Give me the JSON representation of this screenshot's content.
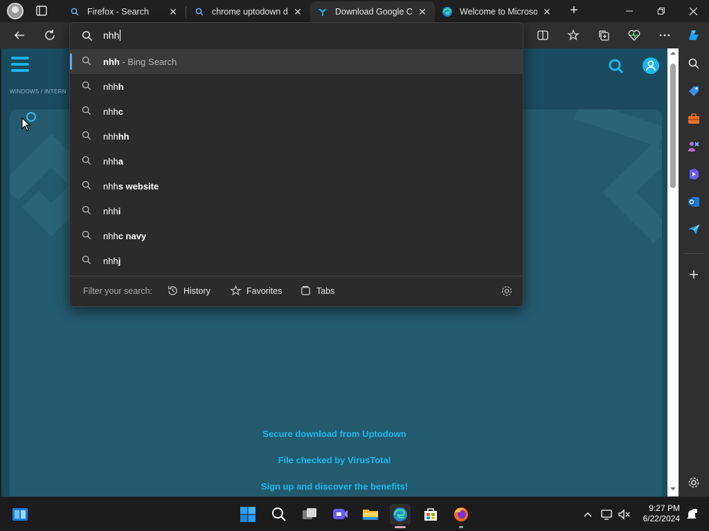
{
  "tabs": [
    {
      "title": "Firefox - Search",
      "favicon": "search-icon"
    },
    {
      "title": "chrome uptodown download",
      "favicon": "search-icon"
    },
    {
      "title": "Download Google Chrome",
      "favicon": "uptodown-icon"
    },
    {
      "title": "Welcome to Microsoft Edge",
      "favicon": "edge-icon"
    }
  ],
  "tab_close_symbol": "✕",
  "new_tab_symbol": "+",
  "address_bar": {
    "typed": "nhh"
  },
  "suggestions": [
    {
      "prefix": "nhh",
      "suffix": "",
      "hint": "- Bing Search"
    },
    {
      "prefix": "nhh",
      "suffix": "h",
      "hint": ""
    },
    {
      "prefix": "nhh",
      "suffix": "c",
      "hint": ""
    },
    {
      "prefix": "nhh",
      "suffix": "hh",
      "hint": ""
    },
    {
      "prefix": "nhh",
      "suffix": "a",
      "hint": ""
    },
    {
      "prefix": "nhh",
      "suffix": "s website",
      "hint": ""
    },
    {
      "prefix": "nhh",
      "suffix": "i",
      "hint": ""
    },
    {
      "prefix": "nhh",
      "suffix": "c navy",
      "hint": ""
    },
    {
      "prefix": "nhh",
      "suffix": "j",
      "hint": ""
    }
  ],
  "filter": {
    "label": "Filter your search:",
    "history": "History",
    "favorites": "Favorites",
    "tabs": "Tabs"
  },
  "page": {
    "breadcrumb": "WINDOWS  /  INTERN",
    "promo_lines": [
      "Secure download from Uptodown",
      "File checked by VirusTotal",
      "Sign up and discover the benefits!"
    ]
  },
  "clock": {
    "time": "9:27 PM",
    "date": "6/22/2024"
  },
  "colors": {
    "page_bg": "#1a4b5f",
    "hero_bg": "#245a6d",
    "accent": "#19b8eb",
    "dropdown_bg": "#2b2b2b",
    "selected_indicator": "#62a9e0"
  }
}
